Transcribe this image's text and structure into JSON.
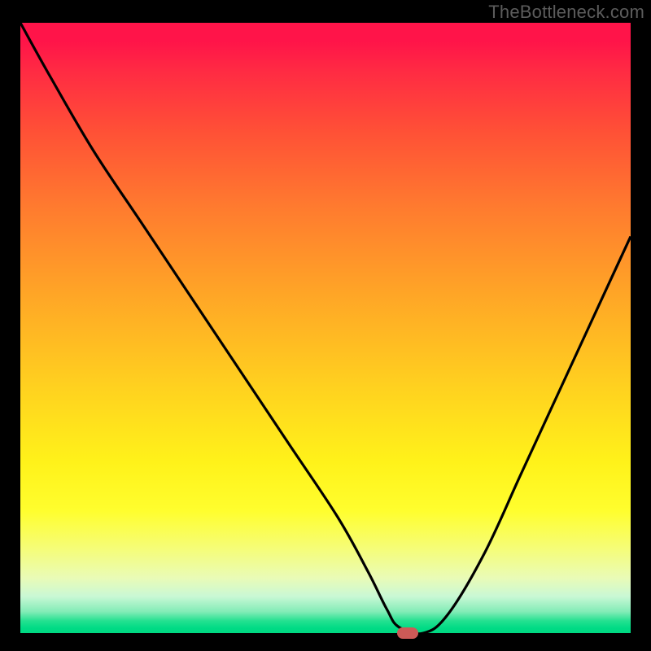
{
  "watermark": "TheBottleneck.com",
  "colors": {
    "background": "#000000",
    "curve_stroke": "#000000",
    "marker_fill": "#cc5a57",
    "watermark_text": "#5c5c5c"
  },
  "chart_data": {
    "type": "line",
    "title": "",
    "xlabel": "",
    "ylabel": "",
    "xlim": [
      0,
      100
    ],
    "ylim": [
      0,
      100
    ],
    "grid": false,
    "legend": false,
    "series": [
      {
        "name": "bottleneck-curve",
        "x": [
          0,
          5,
          12,
          20,
          28,
          36,
          44,
          52,
          57,
          60,
          62,
          66,
          70,
          76,
          82,
          88,
          94,
          100
        ],
        "y": [
          100,
          91,
          79,
          67,
          55,
          43,
          31,
          19,
          10,
          4,
          1,
          0,
          3,
          13,
          26,
          39,
          52,
          65
        ]
      }
    ],
    "annotations": [
      {
        "name": "optimal-marker",
        "x": 63.5,
        "y": 0
      }
    ],
    "background_gradient": {
      "direction": "top-to-bottom",
      "stops": [
        {
          "pos": 0.0,
          "color": "#ff1449"
        },
        {
          "pos": 0.3,
          "color": "#ff7a2f"
        },
        {
          "pos": 0.6,
          "color": "#ffd21f"
        },
        {
          "pos": 0.8,
          "color": "#fffe2e"
        },
        {
          "pos": 0.95,
          "color": "#82ecb7"
        },
        {
          "pos": 1.0,
          "color": "#00d882"
        }
      ]
    }
  }
}
